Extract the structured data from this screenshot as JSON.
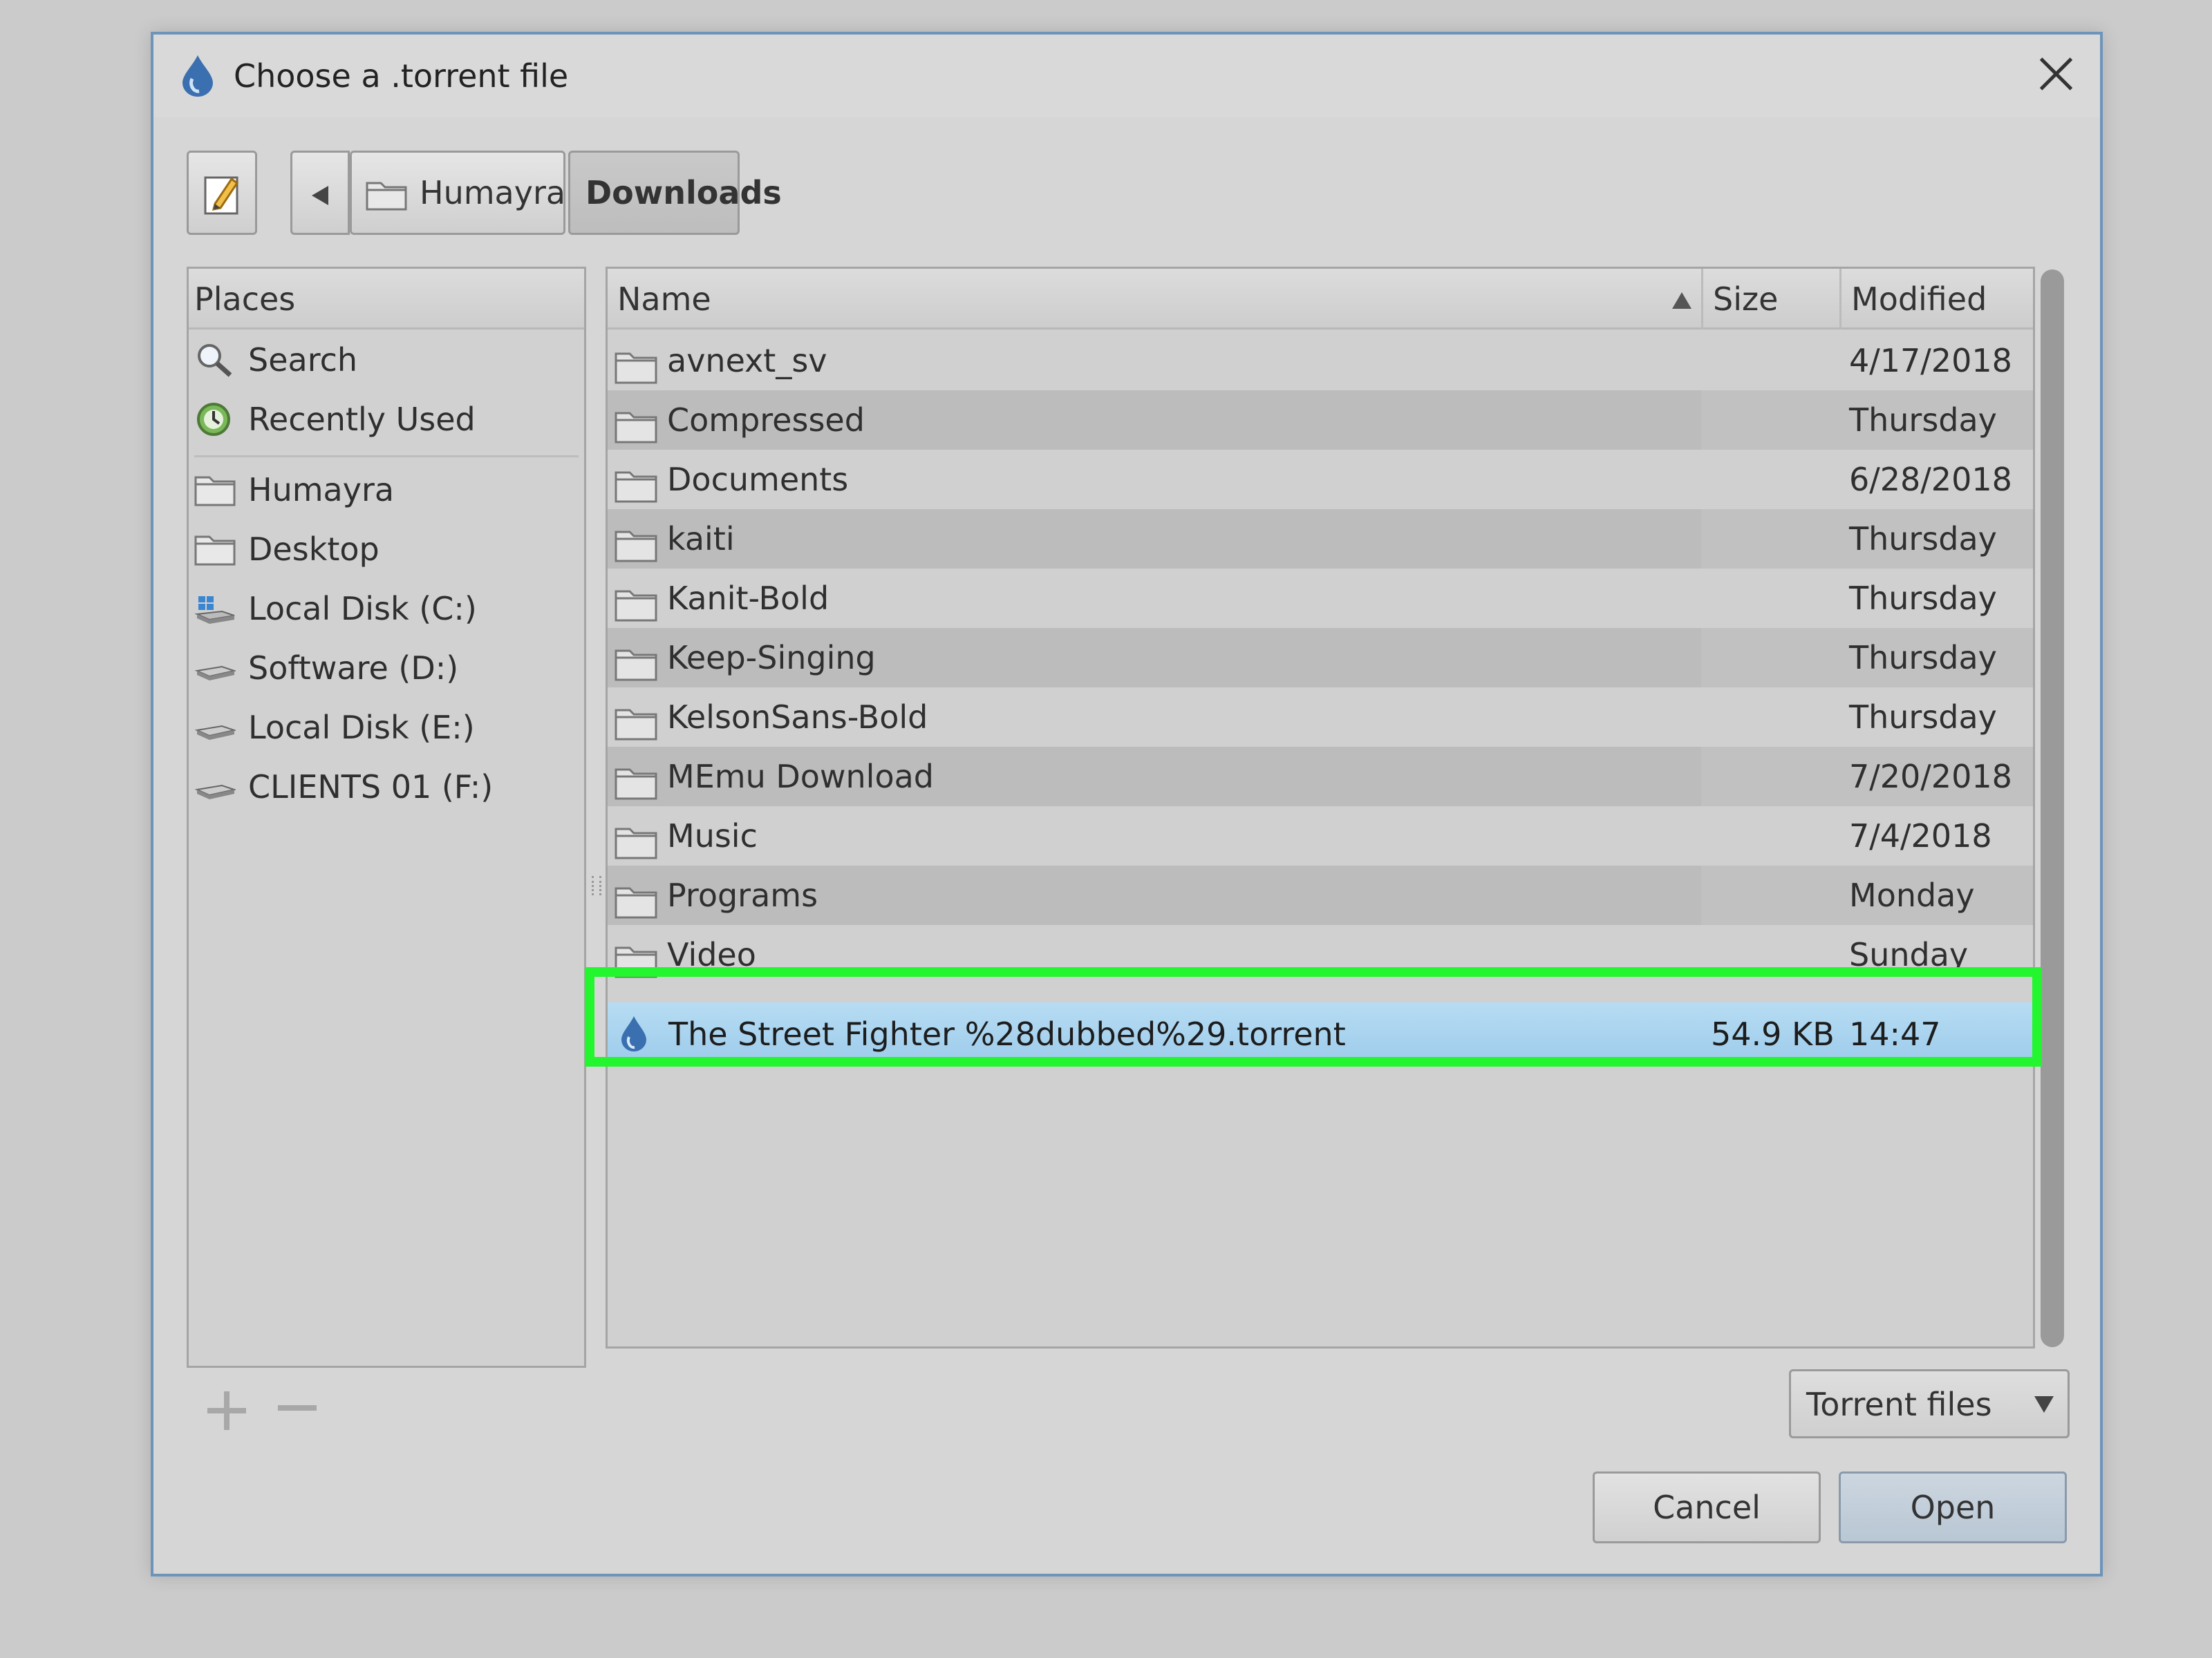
{
  "dialog": {
    "title": "Choose a .torrent file"
  },
  "breadcrumb": {
    "items": [
      "Humayra",
      "Downloads"
    ]
  },
  "places": {
    "header": "Places",
    "items": [
      {
        "label": "Search",
        "icon": "search-icon"
      },
      {
        "label": "Recently Used",
        "icon": "recent-icon"
      },
      {
        "label": "Humayra",
        "icon": "folder-icon"
      },
      {
        "label": "Desktop",
        "icon": "folder-icon"
      },
      {
        "label": "Local Disk (C:)",
        "icon": "system-drive-icon"
      },
      {
        "label": "Software (D:)",
        "icon": "drive-icon"
      },
      {
        "label": "Local Disk (E:)",
        "icon": "drive-icon"
      },
      {
        "label": "CLIENTS 01 (F:)",
        "icon": "drive-icon"
      }
    ]
  },
  "files": {
    "columns": {
      "name": "Name",
      "size": "Size",
      "modified": "Modified"
    },
    "rows": [
      {
        "name": "avnext_sv",
        "size": "",
        "modified": "4/17/2018"
      },
      {
        "name": "Compressed",
        "size": "",
        "modified": "Thursday"
      },
      {
        "name": "Documents",
        "size": "",
        "modified": "6/28/2018"
      },
      {
        "name": "kaiti",
        "size": "",
        "modified": "Thursday"
      },
      {
        "name": "Kanit-Bold",
        "size": "",
        "modified": "Thursday"
      },
      {
        "name": "Keep-Singing",
        "size": "",
        "modified": "Thursday"
      },
      {
        "name": "KelsonSans-Bold",
        "size": "",
        "modified": "Thursday"
      },
      {
        "name": "MEmu Download",
        "size": "",
        "modified": "7/20/2018"
      },
      {
        "name": "Music",
        "size": "",
        "modified": "7/4/2018"
      },
      {
        "name": "Programs",
        "size": "",
        "modified": "Monday"
      },
      {
        "name": "Video",
        "size": "",
        "modified": "Sunday"
      }
    ],
    "selected": {
      "name": "The Street Fighter %28dubbed%29.torrent",
      "size": "54.9 KB",
      "modified": "14:47"
    }
  },
  "filter": {
    "selected": "Torrent files"
  },
  "buttons": {
    "cancel": "Cancel",
    "open": "Open"
  },
  "colors": {
    "highlight": "#23f52e",
    "selection": "#a9d3ef",
    "accent": "#6d94b9"
  }
}
